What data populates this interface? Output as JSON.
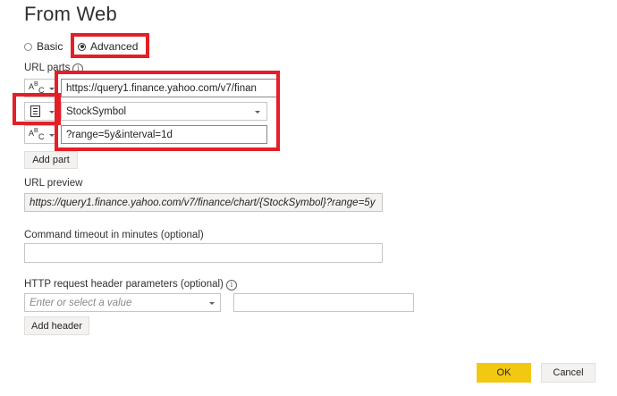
{
  "dialog": {
    "title": "From Web"
  },
  "mode": {
    "basic_label": "Basic",
    "advanced_label": "Advanced",
    "selected": "Advanced"
  },
  "url_parts": {
    "label": "URL parts",
    "parts": [
      {
        "type": "text",
        "value": "https://query1.finance.yahoo.com/v7/finan"
      },
      {
        "type": "parameter",
        "value": "StockSymbol"
      },
      {
        "type": "text",
        "value": "?range=5y&interval=1d"
      }
    ],
    "add_part_label": "Add part"
  },
  "url_preview": {
    "label": "URL preview",
    "value": "https://query1.finance.yahoo.com/v7/finance/chart/{StockSymbol}?range=5y"
  },
  "timeout": {
    "label": "Command timeout in minutes (optional)",
    "value": ""
  },
  "http_headers": {
    "label": "HTTP request header parameters (optional)",
    "name_placeholder": "Enter or select a value",
    "value": "",
    "add_header_label": "Add header"
  },
  "footer": {
    "ok_label": "OK",
    "cancel_label": "Cancel"
  },
  "colors": {
    "highlight": "#e41f27",
    "primary_button": "#f2c811"
  }
}
